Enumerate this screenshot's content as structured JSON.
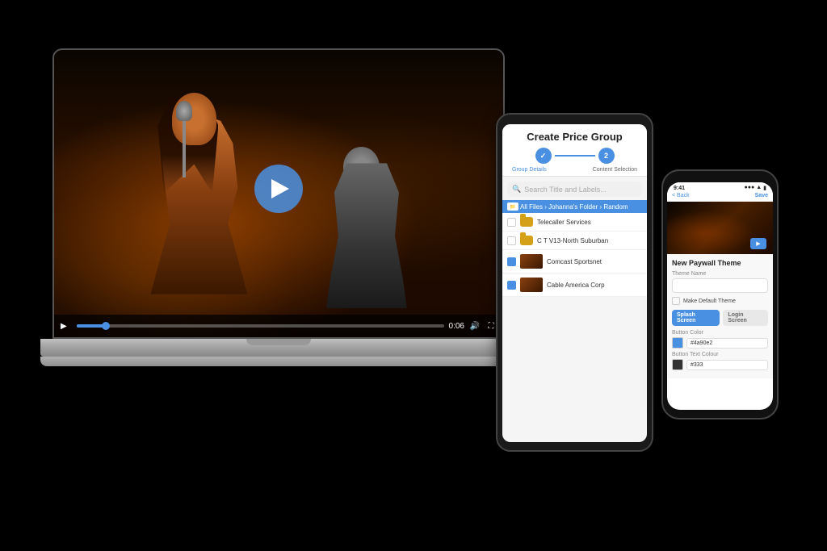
{
  "scene": {
    "background": "#000"
  },
  "laptop": {
    "video": {
      "time": "0:06",
      "play_label": "▶"
    }
  },
  "tablet": {
    "title": "Create Price Group",
    "step1_label": "Group Details",
    "step2_label": "Content Selection",
    "search_placeholder": "Search Title and Labels...",
    "breadcrumb": "All Files › Johanna's Folder › Random",
    "files": [
      {
        "name": "Telecaller Services",
        "type": "folder",
        "checked": false
      },
      {
        "name": "C T V13-North Suburban",
        "type": "folder",
        "checked": false
      },
      {
        "name": "Comcast Sportsnet",
        "type": "video",
        "checked": true
      },
      {
        "name": "Cable America Corp",
        "type": "video",
        "checked": true
      }
    ]
  },
  "phone": {
    "time": "9:41",
    "signal": "●●●",
    "wifi": "▲",
    "battery": "▮",
    "back_label": "< Back",
    "header_title": "",
    "save_label": "Save",
    "section_title": "New Paywall Theme",
    "theme_name_label": "Theme Name",
    "theme_name_value": "",
    "make_default_label": "Make Default Theme",
    "splash_btn": "Splash Screen",
    "login_btn": "Login Screen",
    "button_color_label": "Button Color",
    "button_color_swatch": "#4a90e2",
    "button_color_value": "#4a90e2",
    "text_color_label": "Button Text Colour",
    "text_color_swatch": "#333333",
    "text_color_value": "#333"
  }
}
